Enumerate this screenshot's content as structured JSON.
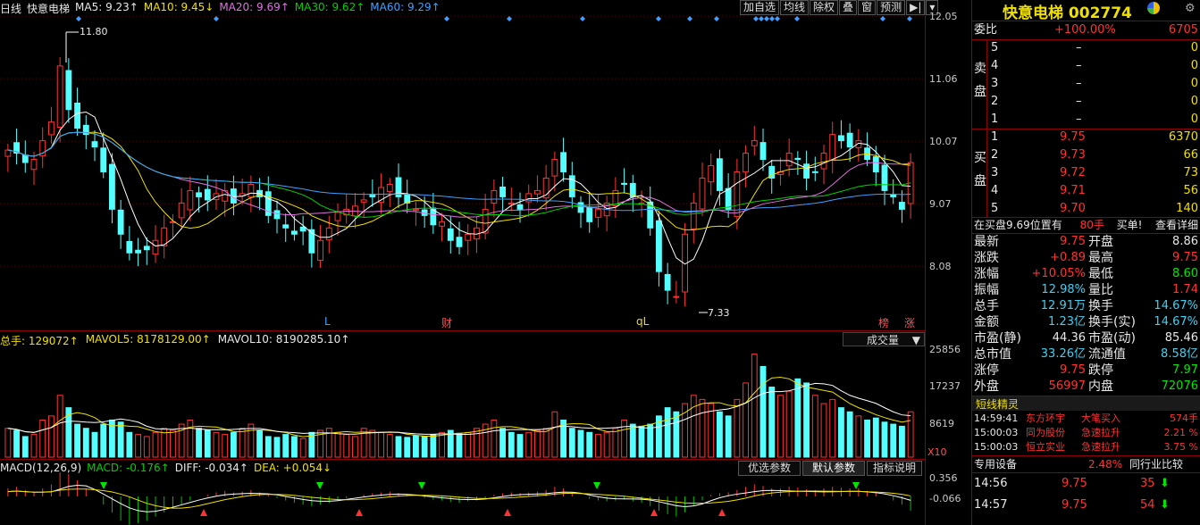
{
  "header": {
    "period": "日线",
    "stock_name": "快意电梯",
    "ma5": "MA5: 9.23↑",
    "ma10": "MA10: 9.45↓",
    "ma20": "MA20: 9.69↑",
    "ma30": "MA30: 9.62↑",
    "ma60": "MA60: 9.29↑",
    "buttons": [
      "加自选",
      "均线",
      "除权",
      "叠",
      "窗",
      "预测"
    ]
  },
  "price_axis": [
    "12.05",
    "11.06",
    "10.07",
    "9.07",
    "8.08"
  ],
  "annotations": {
    "high": "11.80",
    "low": "7.33",
    "markers": [
      "L",
      "财",
      "qL",
      "榜",
      "涨"
    ]
  },
  "volume_header": {
    "total": "总手: 129072↑",
    "mavol5": "MAVOL5: 8178129.00↑",
    "mavol10": "MAVOL10: 8190285.10↑",
    "dropdown": "成交量"
  },
  "volume_axis": [
    "25856",
    "17237",
    "8619"
  ],
  "volume_unit": "X10",
  "macd_header": {
    "params": "MACD(12,26,9)",
    "macd": "MACD: -0.176↑",
    "diff": "DIFF: -0.034↑",
    "dea": "DEA: +0.054↓"
  },
  "macd_tabs": [
    "优选参数",
    "默认参数",
    "指标说明"
  ],
  "macd_axis": [
    "0.356",
    "-0.066"
  ],
  "right": {
    "title": "快意电梯 002774",
    "weibi_label": "委比",
    "weibi_pct": "+100.00%",
    "weibi_val": "6705",
    "sell_label": "卖盘",
    "sell": [
      {
        "level": "5",
        "price": "–",
        "vol": "0"
      },
      {
        "level": "4",
        "price": "–",
        "vol": "0"
      },
      {
        "level": "3",
        "price": "–",
        "vol": "0"
      },
      {
        "level": "2",
        "price": "–",
        "vol": "0"
      },
      {
        "level": "1",
        "price": "–",
        "vol": "0"
      }
    ],
    "buy_label": "买盘",
    "buy": [
      {
        "level": "1",
        "price": "9.75",
        "vol": "6370"
      },
      {
        "level": "2",
        "price": "9.73",
        "vol": "66"
      },
      {
        "level": "3",
        "price": "9.72",
        "vol": "73"
      },
      {
        "level": "4",
        "price": "9.71",
        "vol": "56"
      },
      {
        "level": "5",
        "price": "9.70",
        "vol": "140"
      }
    ],
    "queue_text": "在买盘9.69位置有",
    "queue_hand": "80手",
    "queue_buy": "买单!",
    "queue_detail": "查看详细",
    "stats": [
      {
        "l": "最新",
        "v": "9.75",
        "l2": "开盘",
        "v2": "8.86",
        "c": "red",
        "c2": "white"
      },
      {
        "l": "涨跌",
        "v": "+0.89",
        "l2": "最高",
        "v2": "9.75",
        "c": "red",
        "c2": "red"
      },
      {
        "l": "涨幅",
        "v": "+10.05%",
        "l2": "最低",
        "v2": "8.60",
        "c": "red",
        "c2": "green"
      },
      {
        "l": "振幅",
        "v": "12.98%",
        "l2": "量比",
        "v2": "1.74",
        "c": "cyan",
        "c2": "red"
      },
      {
        "l": "总手",
        "v": "12.91万",
        "l2": "换手",
        "v2": "14.67%",
        "c": "cyan",
        "c2": "cyan"
      },
      {
        "l": "金额",
        "v": "1.23亿",
        "l2": "换手(实)",
        "v2": "14.67%",
        "c": "cyan",
        "c2": "cyan"
      },
      {
        "l": "市盈(静)",
        "v": "44.36",
        "l2": "市盈(动)",
        "v2": "85.46",
        "c": "white",
        "c2": "white"
      },
      {
        "l": "总市值",
        "v": "33.26亿",
        "l2": "流通值",
        "v2": "8.58亿",
        "c": "cyan",
        "c2": "cyan"
      },
      {
        "l": "涨停",
        "v": "9.75",
        "l2": "跌停",
        "v2": "7.97",
        "c": "red",
        "c2": "green"
      },
      {
        "l": "外盘",
        "v": "56997",
        "l2": "内盘",
        "v2": "72076",
        "c": "red",
        "c2": "green"
      }
    ],
    "sprite_title": "短线精灵",
    "sprite": [
      {
        "t": "14:59:41",
        "n": "东方环宇",
        "a": "大笔买入",
        "v": "574手"
      },
      {
        "t": "15:00:03",
        "n": "同为股份",
        "a": "急速拉升",
        "v": "2.21 %"
      },
      {
        "t": "15:00:03",
        "n": "恒立实业",
        "a": "急速拉升",
        "v": "3.75 %"
      }
    ],
    "industry_label": "专用设备",
    "industry_pct": "2.48%",
    "industry_link": "同行业比较",
    "ticks": [
      {
        "t": "14:56",
        "p": "9.75",
        "v": "35"
      },
      {
        "t": "14:57",
        "p": "9.75",
        "v": "54"
      }
    ]
  },
  "colors": {
    "bg": "#000000",
    "up": "#ff3333",
    "down": "#54ffff",
    "grid": "#8b0000"
  },
  "chart_data": {
    "type": "candlestick",
    "ylim": [
      7.2,
      12.1
    ],
    "note": "approximate daily OHLC",
    "close": [
      9.95,
      9.9,
      9.75,
      9.8,
      10.1,
      10.4,
      11.3,
      10.6,
      10.3,
      10.2,
      10.0,
      9.6,
      9.0,
      8.6,
      8.3,
      8.3,
      8.35,
      8.5,
      8.7,
      8.8,
      9.1,
      9.3,
      9.2,
      9.15,
      9.25,
      9.3,
      9.1,
      9.25,
      9.4,
      9.2,
      8.9,
      8.85,
      8.7,
      8.6,
      8.65,
      8.3,
      8.5,
      8.7,
      8.95,
      9.0,
      9.05,
      9.15,
      9.2,
      9.35,
      9.4,
      9.2,
      9.1,
      9.0,
      8.9,
      8.75,
      8.8,
      8.5,
      8.4,
      8.6,
      8.7,
      9.0,
      9.3,
      9.2,
      9.1,
      9.0,
      9.25,
      9.3,
      9.5,
      9.8,
      9.6,
      9.2,
      8.95,
      8.8,
      9.0,
      9.1,
      9.3,
      9.4,
      9.2,
      9.1,
      8.7,
      8.0,
      7.7,
      7.6,
      8.6,
      9.1,
      9.5,
      9.7,
      9.3,
      9.0,
      9.6,
      9.9,
      10.1,
      9.8,
      9.5,
      9.6,
      9.9,
      9.8,
      9.5,
      9.6,
      9.9,
      10.2,
      10.1,
      10.0,
      10.1,
      9.8,
      9.6,
      9.3,
      9.2,
      9.0,
      9.75
    ],
    "volume": [
      7000,
      6500,
      5000,
      5500,
      9000,
      10000,
      15000,
      12000,
      8000,
      7000,
      6000,
      8000,
      9000,
      8500,
      6000,
      5500,
      5000,
      6000,
      7000,
      6500,
      8000,
      9000,
      7000,
      6500,
      6000,
      5500,
      6000,
      7000,
      8000,
      6500,
      5000,
      4800,
      5500,
      5000,
      4500,
      6000,
      6500,
      7000,
      6000,
      5500,
      5000,
      7000,
      6500,
      6000,
      5500,
      5000,
      4800,
      5200,
      5000,
      5500,
      6000,
      6500,
      5800,
      6000,
      7000,
      8000,
      9000,
      7000,
      6000,
      5500,
      6000,
      6500,
      7000,
      11000,
      9000,
      7000,
      6500,
      6000,
      5500,
      6000,
      7000,
      9000,
      8000,
      7500,
      8000,
      10000,
      12000,
      11000,
      13000,
      15000,
      14000,
      13000,
      11000,
      10000,
      14000,
      18000,
      25000,
      22000,
      17000,
      15000,
      16000,
      19000,
      18000,
      15000,
      13000,
      14000,
      12000,
      11000,
      10000,
      9000,
      9500,
      8500,
      8000,
      7500,
      11000
    ],
    "macd": [
      0.1,
      0.12,
      0.08,
      0.05,
      0.1,
      0.15,
      0.3,
      0.28,
      0.2,
      0.1,
      0.0,
      -0.1,
      -0.2,
      -0.3,
      -0.35,
      -0.33,
      -0.3,
      -0.25,
      -0.2,
      -0.15,
      -0.1,
      -0.05,
      0.0,
      0.02,
      0.05,
      0.07,
      0.05,
      0.06,
      0.08,
      0.05,
      0.02,
      -0.02,
      -0.05,
      -0.08,
      -0.1,
      -0.12,
      -0.1,
      -0.08,
      -0.05,
      -0.02,
      0.0,
      0.02,
      0.04,
      0.05,
      0.06,
      0.04,
      0.02,
      0.0,
      -0.02,
      -0.04,
      -0.05,
      -0.07,
      -0.08,
      -0.06,
      -0.05,
      -0.02,
      0.02,
      0.04,
      0.05,
      0.04,
      0.05,
      0.06,
      0.08,
      0.12,
      0.1,
      0.05,
      0.0,
      -0.03,
      -0.05,
      -0.06,
      -0.05,
      -0.04,
      -0.06,
      -0.08,
      -0.12,
      -0.18,
      -0.22,
      -0.25,
      -0.2,
      -0.12,
      -0.05,
      0.02,
      0.04,
      0.05,
      0.08,
      0.12,
      0.15,
      0.13,
      0.1,
      0.1,
      0.12,
      0.11,
      0.09,
      0.08,
      0.1,
      0.12,
      0.11,
      0.1,
      0.1,
      0.07,
      0.04,
      0.0,
      -0.05,
      -0.1,
      -0.176
    ]
  }
}
